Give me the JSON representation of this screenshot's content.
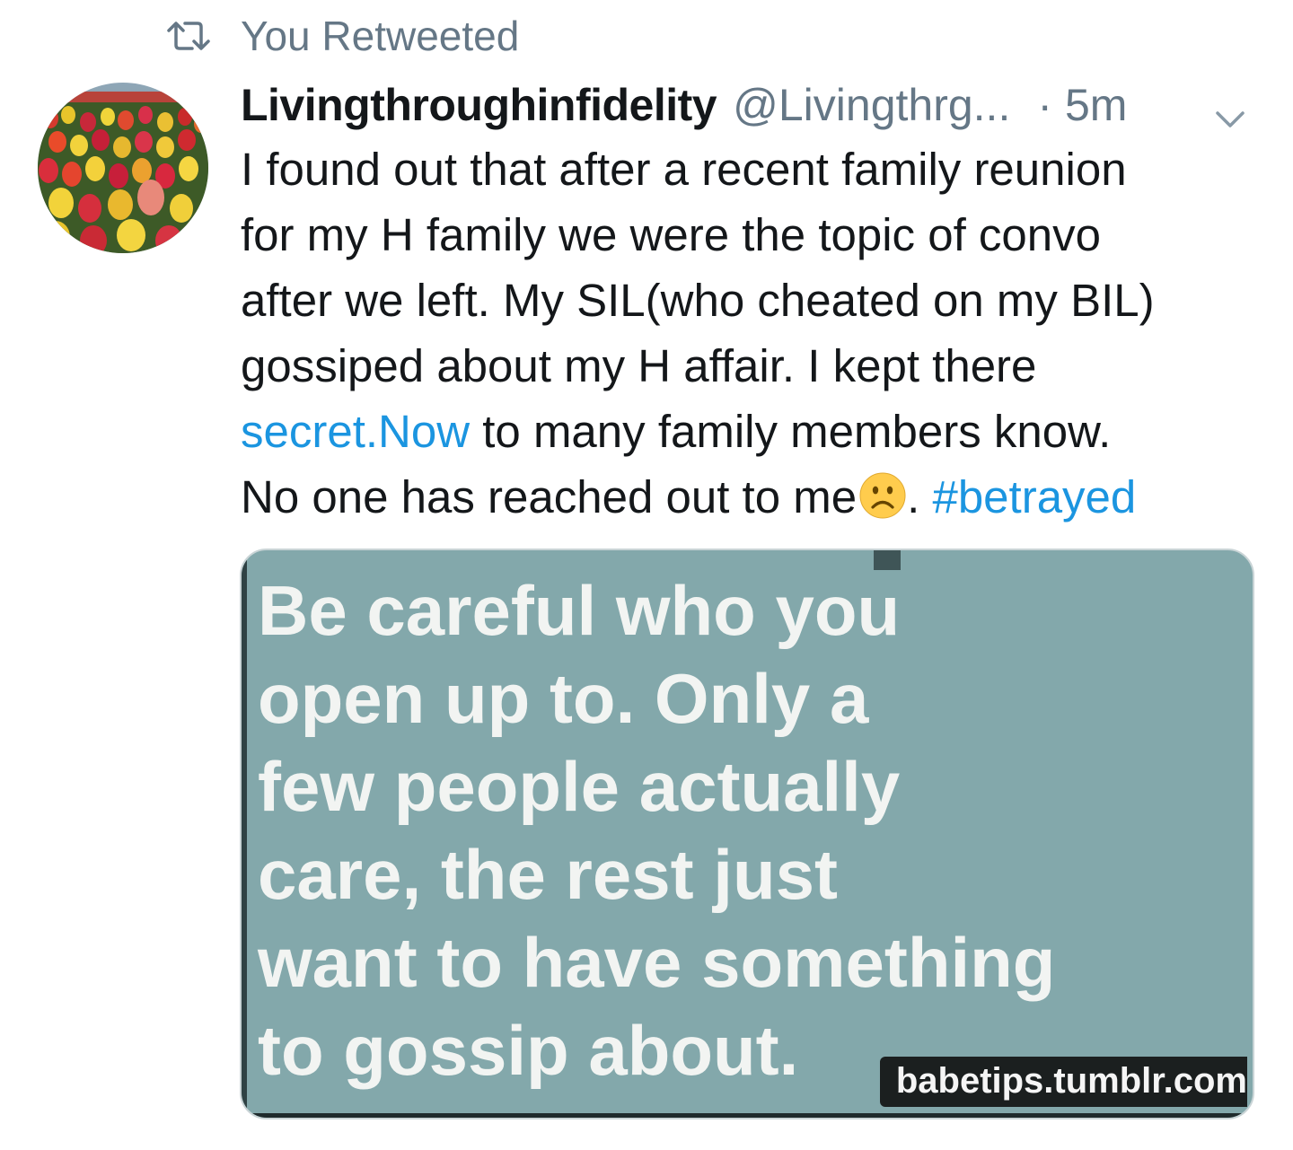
{
  "retweet": {
    "icon": "retweet-icon",
    "label": "You Retweeted"
  },
  "tweet": {
    "avatar_icon": "tulip-field-avatar",
    "display_name": "Livingthroughinfidelity",
    "handle": "@Livingthrg...",
    "separator": "·",
    "time": "5m",
    "menu_icon": "chevron-down-icon",
    "text": {
      "line1": "I found out that after a recent family reunion",
      "line2": "for my H family we were the topic of convo",
      "line3": "after we left. My SIL(who cheated on my BIL)",
      "line4": "gossiped about my H affair.  I kept there",
      "link": "secret.Now",
      "line5_rest": " to many family members know.",
      "line6": "No one has reached out to me",
      "emoji_name": "frowning-face-emoji",
      "line6_punct": ". ",
      "hashtag": "#betrayed"
    },
    "media": {
      "quote_lines": [
        "Be careful who you",
        "open up to. Only a",
        "few people actually",
        "care, the rest just",
        "want to have something",
        "to gossip about."
      ],
      "watermark": "babetips.tumblr.com"
    }
  },
  "colors": {
    "link": "#1b95e0",
    "secondary_text": "#657786",
    "primary_text": "#14171a",
    "media_background": "#83a8ab"
  }
}
